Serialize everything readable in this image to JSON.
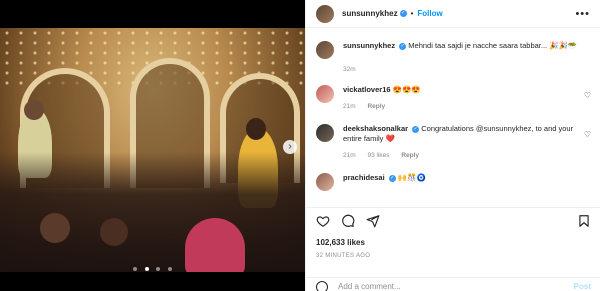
{
  "post": {
    "author": "sunsunnykhez",
    "follow_label": "Follow",
    "separator": "•",
    "caption": "Mehndi taa sajdi je nacche saara tabbar...",
    "caption_emoji": "🎉🎉🥗",
    "caption_time": "32m",
    "likes": "102,633 likes",
    "time_ago": "32 MINUTES AGO"
  },
  "comments": [
    {
      "user": "vickatlover16",
      "text": "😍😍😍",
      "time": "21m",
      "likes": "",
      "reply": "Reply",
      "verified": false
    },
    {
      "user": "deekshaksonalkar",
      "text": "Congratulations @sunsunnykhez, to and your entire family ❤️",
      "time": "21m",
      "likes": "93 likes",
      "reply": "Reply",
      "verified": true
    },
    {
      "user": "prachidesai",
      "text": "🙌🎊🧿",
      "time": "",
      "likes": "",
      "reply": "",
      "verified": true
    }
  ],
  "add_comment": {
    "placeholder": "Add a comment...",
    "post_label": "Post"
  },
  "icons": {
    "more": "more-options-icon",
    "heart": "heart-icon",
    "comment": "comment-icon",
    "share": "share-icon",
    "save": "bookmark-icon",
    "emoji": "emoji-icon",
    "next": "chevron-right-icon"
  },
  "colors": {
    "accent": "#0095f6",
    "verified": "#3897f0",
    "muted": "#8e8e8e"
  },
  "carousel": {
    "slides": 4,
    "active_index": 2,
    "next_glyph": "›"
  }
}
